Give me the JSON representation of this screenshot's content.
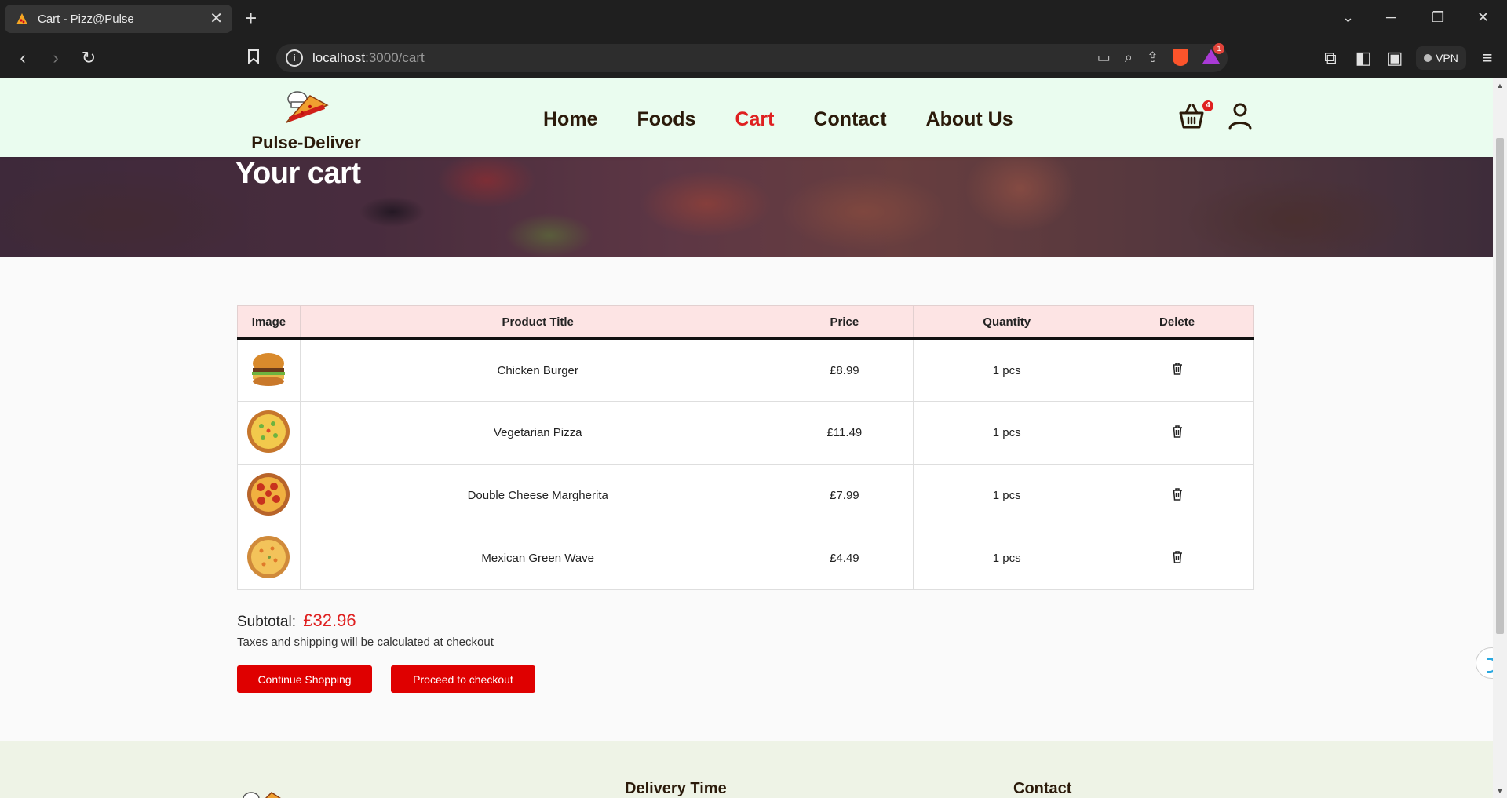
{
  "browser": {
    "tab_title": "Cart - Pizz@Pulse",
    "new_tab": "+",
    "url_host": "localhost",
    "url_path": ":3000/cart",
    "vpn_label": "VPN",
    "rewards_count": "1"
  },
  "site": {
    "brand": "Pulse-Deliver",
    "nav": [
      {
        "label": "Home"
      },
      {
        "label": "Foods"
      },
      {
        "label": "Cart"
      },
      {
        "label": "Contact"
      },
      {
        "label": "About Us"
      }
    ],
    "active_nav": "Cart",
    "cart_count": "4"
  },
  "hero": {
    "title": "Your cart"
  },
  "cart": {
    "headers": {
      "image": "Image",
      "title": "Product Title",
      "price": "Price",
      "quantity": "Quantity",
      "delete": "Delete"
    },
    "items": [
      {
        "title": "Chicken Burger",
        "price": "£8.99",
        "quantity": "1 pcs",
        "image": "burger-image"
      },
      {
        "title": "Vegetarian Pizza",
        "price": "£11.49",
        "quantity": "1 pcs",
        "image": "pizza-image"
      },
      {
        "title": "Double Cheese Margherita",
        "price": "£7.99",
        "quantity": "1 pcs",
        "image": "pizza-image"
      },
      {
        "title": "Mexican Green Wave",
        "price": "£4.49",
        "quantity": "1 pcs",
        "image": "pizza-image"
      }
    ],
    "subtotal_label": "Subtotal:",
    "subtotal_value": "£32.96",
    "tax_note": "Taxes and shipping will be calculated at checkout",
    "continue_label": "Continue Shopping",
    "checkout_label": "Proceed to checkout"
  },
  "footer": {
    "delivery_heading": "Delivery Time",
    "contact_heading": "Contact"
  },
  "colors": {
    "accent": "#df2020",
    "header_bg": "#eafcef",
    "table_header_bg": "#fde4e4",
    "button_bg": "#df0000"
  }
}
